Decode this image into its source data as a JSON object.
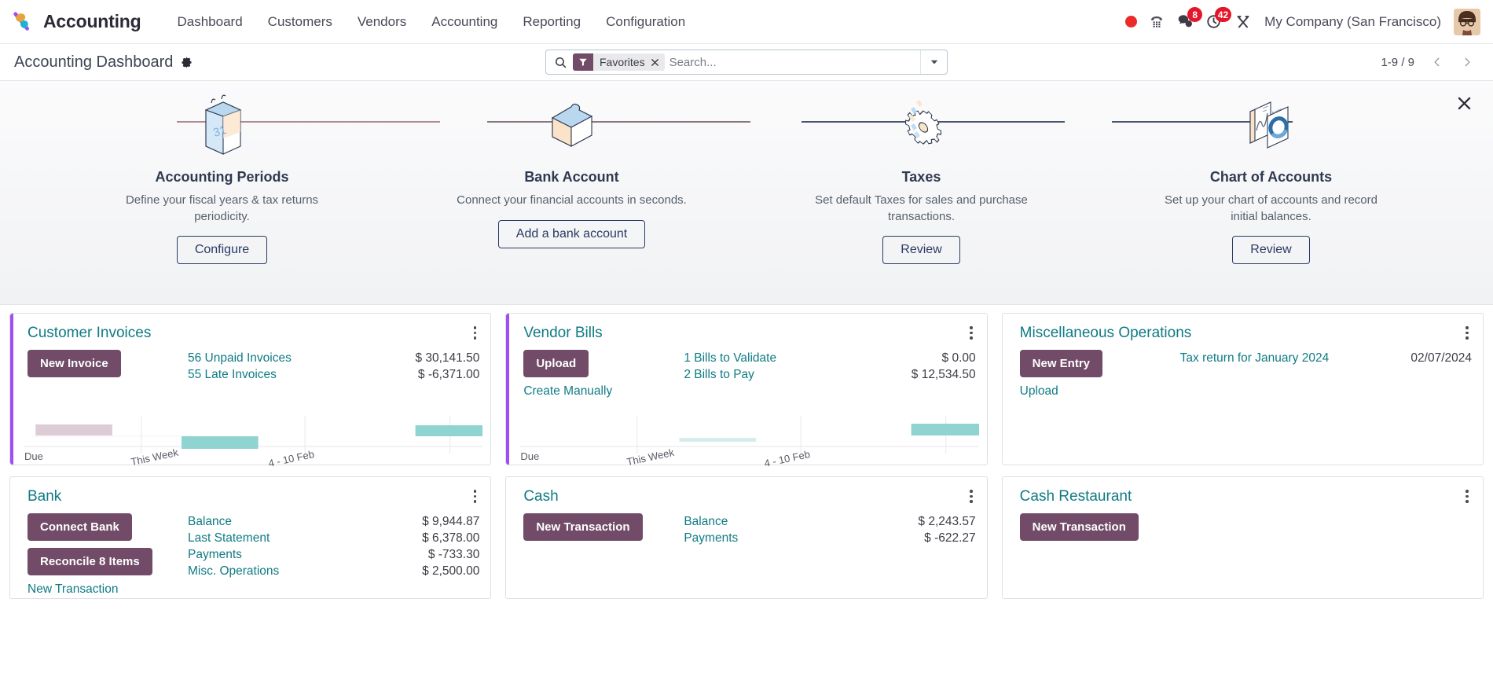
{
  "app": {
    "name": "Accounting",
    "logo_icon": "odoo-logo-icon"
  },
  "navbar": {
    "menu_items": [
      {
        "label": "Dashboard",
        "name": "nav-dashboard"
      },
      {
        "label": "Customers",
        "name": "nav-customers"
      },
      {
        "label": "Vendors",
        "name": "nav-vendors"
      },
      {
        "label": "Accounting",
        "name": "nav-accounting"
      },
      {
        "label": "Reporting",
        "name": "nav-reporting"
      },
      {
        "label": "Configuration",
        "name": "nav-configuration"
      }
    ],
    "systray": {
      "recording_icon": "record-dot-icon",
      "dialpad_icon": "dialpad-icon",
      "messages_icon": "chat-bubble-icon",
      "messages_count": "8",
      "activities_icon": "clock-icon",
      "activities_count": "42",
      "tools_icon": "tools-icon",
      "company": "My Company (San Francisco)",
      "avatar_icon": "user-avatar"
    }
  },
  "control_panel": {
    "title": "Accounting Dashboard",
    "settings_icon": "gear-icon",
    "search": {
      "search_icon": "search-icon",
      "facet_icon": "filter-funnel-icon",
      "facet_label": "Favorites",
      "facet_remove_icon": "close-icon",
      "placeholder": "Search...",
      "value": "",
      "dropdown_icon": "chevron-down-icon"
    },
    "pager": {
      "count": "1-9 / 9",
      "prev_icon": "chevron-left-icon",
      "next_icon": "chevron-right-icon"
    }
  },
  "onboarding": {
    "close_icon": "close-icon",
    "steps": [
      {
        "name": "accounting-periods",
        "icon": "calendar-31-icon",
        "title": "Accounting Periods",
        "description": "Define your fiscal years & tax returns periodicity.",
        "button": "Configure"
      },
      {
        "name": "bank-account",
        "icon": "puzzle-piece-icon",
        "title": "Bank Account",
        "description": "Connect your financial accounts in seconds.",
        "button": "Add a bank account"
      },
      {
        "name": "taxes",
        "icon": "gear-cog-icon",
        "title": "Taxes",
        "description": "Set default Taxes for sales and purchase transactions.",
        "button": "Review"
      },
      {
        "name": "chart-of-accounts",
        "icon": "chart-donut-icon",
        "title": "Chart of Accounts",
        "description": "Set up your chart of accounts and record initial balances.",
        "button": "Review"
      }
    ]
  },
  "journals": {
    "customer_invoices": {
      "title": "Customer Invoices",
      "primary_button": "New Invoice",
      "stats": [
        {
          "label": "56 Unpaid Invoices",
          "value": "$ 30,141.50"
        },
        {
          "label": "55 Late Invoices",
          "value": "$ -6,371.00"
        }
      ],
      "graph_labels": [
        "Due",
        "This Week",
        "4 - 10 Feb"
      ]
    },
    "vendor_bills": {
      "title": "Vendor Bills",
      "primary_button": "Upload",
      "secondary_link": "Create Manually",
      "stats": [
        {
          "label": "1 Bills to Validate",
          "value": "$ 0.00"
        },
        {
          "label": "2 Bills to Pay",
          "value": "$ 12,534.50"
        }
      ],
      "graph_labels": [
        "Due",
        "This Week",
        "4 - 10 Feb"
      ]
    },
    "misc_operations": {
      "title": "Miscellaneous Operations",
      "primary_button": "New Entry",
      "secondary_link": "Upload",
      "stats": [
        {
          "label": "Tax return for January 2024",
          "value": "02/07/2024"
        }
      ]
    },
    "bank": {
      "title": "Bank",
      "primary_button": "Connect Bank",
      "secondary_button": "Reconcile 8 Items",
      "secondary_link": "New Transaction",
      "stats": [
        {
          "label": "Balance",
          "value": "$ 9,944.87"
        },
        {
          "label": "Last Statement",
          "value": "$ 6,378.00"
        },
        {
          "label": "Payments",
          "value": "$ -733.30"
        },
        {
          "label": "Misc. Operations",
          "value": "$ 2,500.00"
        }
      ]
    },
    "cash": {
      "title": "Cash",
      "primary_button": "New Transaction",
      "stats": [
        {
          "label": "Balance",
          "value": "$ 2,243.57"
        },
        {
          "label": "Payments",
          "value": "$ -622.27"
        }
      ]
    },
    "cash_restaurant": {
      "title": "Cash Restaurant",
      "primary_button": "New Transaction",
      "stats": []
    }
  },
  "colors": {
    "brand_purple": "#714b67",
    "accent_bar": "#a24cf3",
    "link_teal": "#0f7b84",
    "badge_red": "#e5152a",
    "graph_teal": "#8fd4d0",
    "graph_mauve": "#ddccd6",
    "onboarding_line_left": "#b08a97",
    "onboarding_line_right": "#4a5570"
  },
  "chart_data": [
    {
      "name": "customer-invoices-graph",
      "type": "bar",
      "categories": [
        "Due",
        "This Week",
        "4 - 10 Feb"
      ],
      "tick_labels": [
        "Due",
        "This Week",
        "4 - 10 Feb"
      ],
      "bars": [
        {
          "x": 0.02,
          "width": 0.175,
          "value": -6371.0,
          "color": "#ddccd6"
        },
        {
          "x": 0.34,
          "width": 0.175,
          "value": 9800.0,
          "color": "#8fd4d0"
        },
        {
          "x": 0.865,
          "width": 0.175,
          "value": 8200.0,
          "color": "#8fd4d0"
        }
      ],
      "grid": true,
      "baseline": 0
    },
    {
      "name": "vendor-bills-graph",
      "type": "bar",
      "categories": [
        "Due",
        "This Week",
        "4 - 10 Feb"
      ],
      "tick_labels": [
        "Due",
        "This Week",
        "4 - 10 Feb"
      ],
      "bars": [
        {
          "x": 0.345,
          "width": 0.175,
          "value": 600.0,
          "color": "#d8ecec"
        },
        {
          "x": 0.865,
          "width": 0.175,
          "value": 12534.5,
          "color": "#8fd4d0"
        }
      ],
      "grid": true,
      "baseline": 0
    }
  ]
}
